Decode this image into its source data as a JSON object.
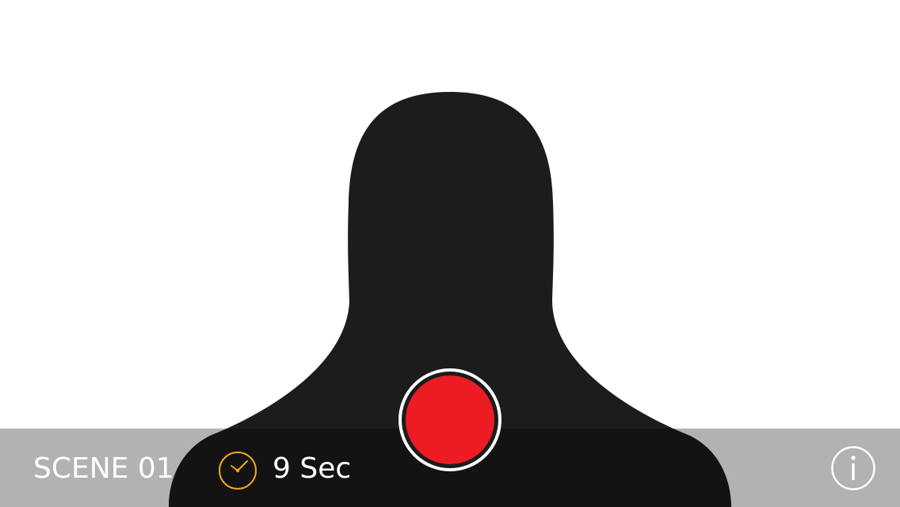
{
  "scene": {
    "label": "SCENE 01"
  },
  "timer": {
    "icon": "clock-icon",
    "icon_color": "#F2A623",
    "duration_label": "9 Sec"
  },
  "record": {
    "icon": "record-icon",
    "color": "#ED1C24"
  },
  "info": {
    "icon": "info-icon"
  },
  "colors": {
    "background": "#FFFFFF",
    "silhouette": "#1C1C1C",
    "bar": "#B3B3B3"
  }
}
